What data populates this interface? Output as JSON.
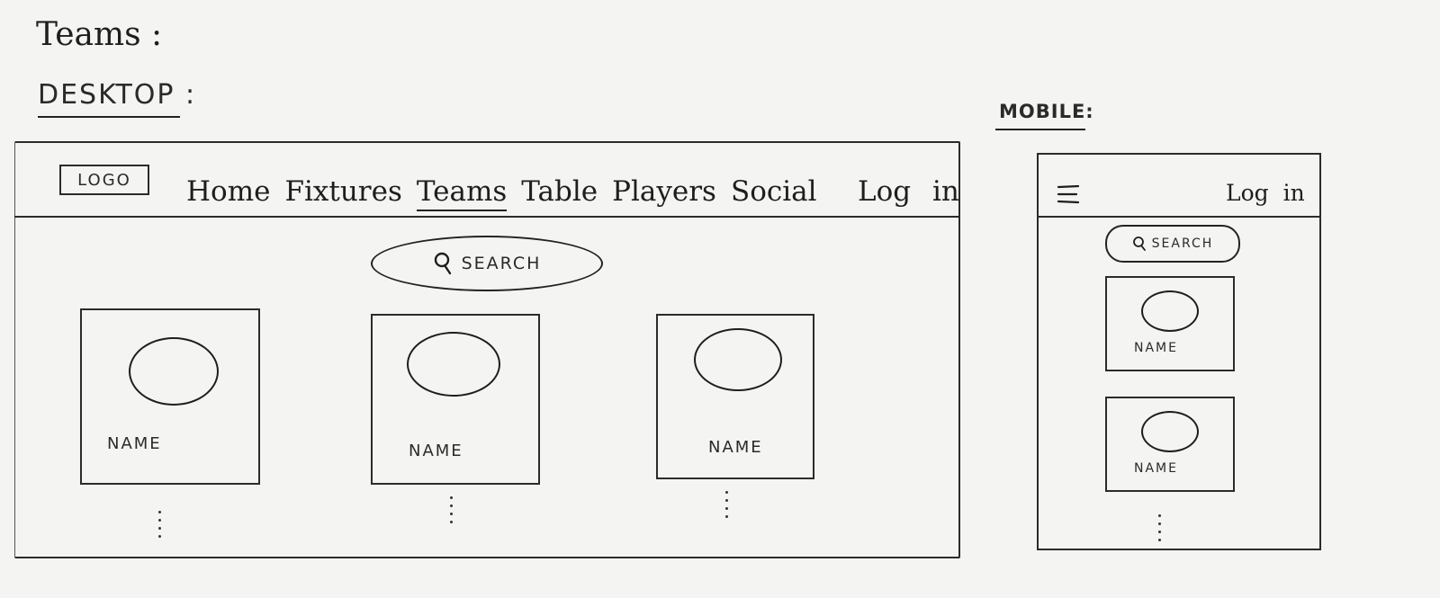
{
  "page_title": "Teams :",
  "desktop": {
    "label": "DESKTOP :",
    "logo": "LOGO",
    "nav": [
      {
        "label": "Home",
        "active": false
      },
      {
        "label": "Fixtures",
        "active": false
      },
      {
        "label": "Teams",
        "active": true
      },
      {
        "label": "Table",
        "active": false
      },
      {
        "label": "Players",
        "active": false
      },
      {
        "label": "Social",
        "active": false
      }
    ],
    "login": "Log in",
    "search": {
      "icon": "search-icon",
      "label": "SEARCH"
    },
    "cards": [
      {
        "name": "NAME",
        "icon": "circle"
      },
      {
        "name": "NAME",
        "icon": "circle"
      },
      {
        "name": "NAME",
        "icon": "circle"
      }
    ]
  },
  "mobile": {
    "label": "MOBILE:",
    "menu_icon": "hamburger-icon",
    "login": "Log in",
    "search": {
      "icon": "search-icon",
      "label": "SEARCH"
    },
    "cards": [
      {
        "name": "NAME",
        "icon": "circle"
      },
      {
        "name": "NAME",
        "icon": "circle"
      }
    ]
  }
}
